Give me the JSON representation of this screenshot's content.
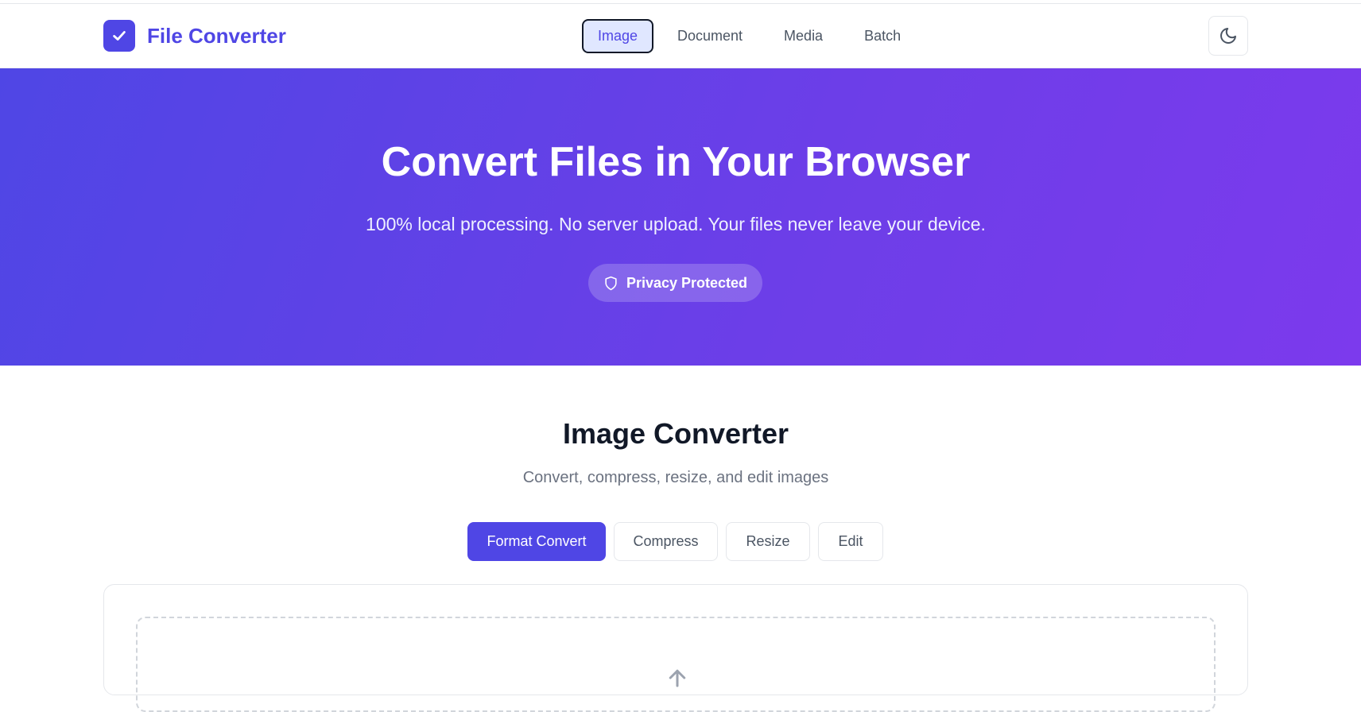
{
  "brand": {
    "name": "File Converter",
    "logo_icon": "check-icon",
    "accent": "#4f46e5"
  },
  "nav": {
    "items": [
      {
        "label": "Image",
        "active": true
      },
      {
        "label": "Document",
        "active": false
      },
      {
        "label": "Media",
        "active": false
      },
      {
        "label": "Batch",
        "active": false
      }
    ],
    "theme_toggle_icon": "moon-icon"
  },
  "hero": {
    "title": "Convert Files in Your Browser",
    "subtitle": "100% local processing. No server upload. Your files never leave your device.",
    "badge": "Privacy Protected",
    "badge_icon": "shield-icon",
    "gradient": [
      "#4f46e5",
      "#7c3aed"
    ]
  },
  "converter": {
    "title": "Image Converter",
    "subtitle": "Convert, compress, resize, and edit images",
    "tabs": [
      {
        "label": "Format Convert",
        "active": true
      },
      {
        "label": "Compress",
        "active": false
      },
      {
        "label": "Resize",
        "active": false
      },
      {
        "label": "Edit",
        "active": false
      }
    ],
    "dropzone_icon": "upload-arrow-icon"
  }
}
